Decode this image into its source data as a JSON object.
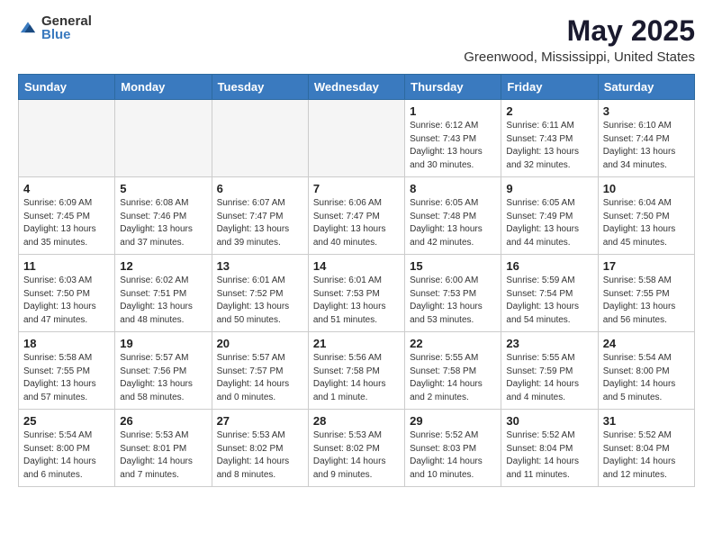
{
  "logo": {
    "general": "General",
    "blue": "Blue"
  },
  "title": "May 2025",
  "subtitle": "Greenwood, Mississippi, United States",
  "weekdays": [
    "Sunday",
    "Monday",
    "Tuesday",
    "Wednesday",
    "Thursday",
    "Friday",
    "Saturday"
  ],
  "weeks": [
    [
      {
        "day": "",
        "info": ""
      },
      {
        "day": "",
        "info": ""
      },
      {
        "day": "",
        "info": ""
      },
      {
        "day": "",
        "info": ""
      },
      {
        "day": "1",
        "info": "Sunrise: 6:12 AM\nSunset: 7:43 PM\nDaylight: 13 hours\nand 30 minutes."
      },
      {
        "day": "2",
        "info": "Sunrise: 6:11 AM\nSunset: 7:43 PM\nDaylight: 13 hours\nand 32 minutes."
      },
      {
        "day": "3",
        "info": "Sunrise: 6:10 AM\nSunset: 7:44 PM\nDaylight: 13 hours\nand 34 minutes."
      }
    ],
    [
      {
        "day": "4",
        "info": "Sunrise: 6:09 AM\nSunset: 7:45 PM\nDaylight: 13 hours\nand 35 minutes."
      },
      {
        "day": "5",
        "info": "Sunrise: 6:08 AM\nSunset: 7:46 PM\nDaylight: 13 hours\nand 37 minutes."
      },
      {
        "day": "6",
        "info": "Sunrise: 6:07 AM\nSunset: 7:47 PM\nDaylight: 13 hours\nand 39 minutes."
      },
      {
        "day": "7",
        "info": "Sunrise: 6:06 AM\nSunset: 7:47 PM\nDaylight: 13 hours\nand 40 minutes."
      },
      {
        "day": "8",
        "info": "Sunrise: 6:05 AM\nSunset: 7:48 PM\nDaylight: 13 hours\nand 42 minutes."
      },
      {
        "day": "9",
        "info": "Sunrise: 6:05 AM\nSunset: 7:49 PM\nDaylight: 13 hours\nand 44 minutes."
      },
      {
        "day": "10",
        "info": "Sunrise: 6:04 AM\nSunset: 7:50 PM\nDaylight: 13 hours\nand 45 minutes."
      }
    ],
    [
      {
        "day": "11",
        "info": "Sunrise: 6:03 AM\nSunset: 7:50 PM\nDaylight: 13 hours\nand 47 minutes."
      },
      {
        "day": "12",
        "info": "Sunrise: 6:02 AM\nSunset: 7:51 PM\nDaylight: 13 hours\nand 48 minutes."
      },
      {
        "day": "13",
        "info": "Sunrise: 6:01 AM\nSunset: 7:52 PM\nDaylight: 13 hours\nand 50 minutes."
      },
      {
        "day": "14",
        "info": "Sunrise: 6:01 AM\nSunset: 7:53 PM\nDaylight: 13 hours\nand 51 minutes."
      },
      {
        "day": "15",
        "info": "Sunrise: 6:00 AM\nSunset: 7:53 PM\nDaylight: 13 hours\nand 53 minutes."
      },
      {
        "day": "16",
        "info": "Sunrise: 5:59 AM\nSunset: 7:54 PM\nDaylight: 13 hours\nand 54 minutes."
      },
      {
        "day": "17",
        "info": "Sunrise: 5:58 AM\nSunset: 7:55 PM\nDaylight: 13 hours\nand 56 minutes."
      }
    ],
    [
      {
        "day": "18",
        "info": "Sunrise: 5:58 AM\nSunset: 7:55 PM\nDaylight: 13 hours\nand 57 minutes."
      },
      {
        "day": "19",
        "info": "Sunrise: 5:57 AM\nSunset: 7:56 PM\nDaylight: 13 hours\nand 58 minutes."
      },
      {
        "day": "20",
        "info": "Sunrise: 5:57 AM\nSunset: 7:57 PM\nDaylight: 14 hours\nand 0 minutes."
      },
      {
        "day": "21",
        "info": "Sunrise: 5:56 AM\nSunset: 7:58 PM\nDaylight: 14 hours\nand 1 minute."
      },
      {
        "day": "22",
        "info": "Sunrise: 5:55 AM\nSunset: 7:58 PM\nDaylight: 14 hours\nand 2 minutes."
      },
      {
        "day": "23",
        "info": "Sunrise: 5:55 AM\nSunset: 7:59 PM\nDaylight: 14 hours\nand 4 minutes."
      },
      {
        "day": "24",
        "info": "Sunrise: 5:54 AM\nSunset: 8:00 PM\nDaylight: 14 hours\nand 5 minutes."
      }
    ],
    [
      {
        "day": "25",
        "info": "Sunrise: 5:54 AM\nSunset: 8:00 PM\nDaylight: 14 hours\nand 6 minutes."
      },
      {
        "day": "26",
        "info": "Sunrise: 5:53 AM\nSunset: 8:01 PM\nDaylight: 14 hours\nand 7 minutes."
      },
      {
        "day": "27",
        "info": "Sunrise: 5:53 AM\nSunset: 8:02 PM\nDaylight: 14 hours\nand 8 minutes."
      },
      {
        "day": "28",
        "info": "Sunrise: 5:53 AM\nSunset: 8:02 PM\nDaylight: 14 hours\nand 9 minutes."
      },
      {
        "day": "29",
        "info": "Sunrise: 5:52 AM\nSunset: 8:03 PM\nDaylight: 14 hours\nand 10 minutes."
      },
      {
        "day": "30",
        "info": "Sunrise: 5:52 AM\nSunset: 8:04 PM\nDaylight: 14 hours\nand 11 minutes."
      },
      {
        "day": "31",
        "info": "Sunrise: 5:52 AM\nSunset: 8:04 PM\nDaylight: 14 hours\nand 12 minutes."
      }
    ]
  ]
}
